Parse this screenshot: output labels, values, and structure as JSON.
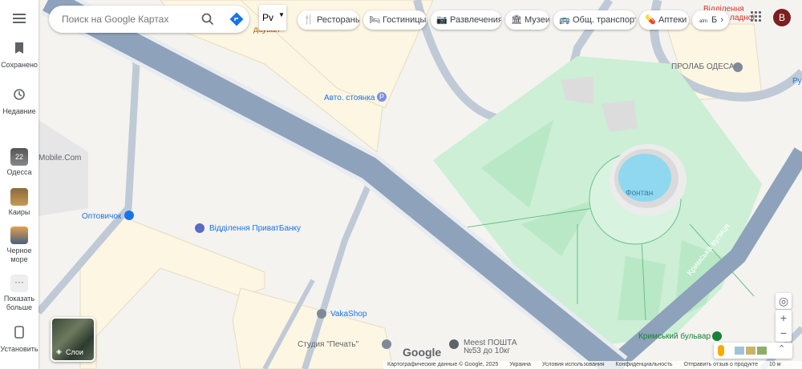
{
  "sidebar": {
    "menu_icon": "hamburger-icon",
    "items": [
      {
        "icon": "bookmark-icon",
        "label": "Сохранено"
      },
      {
        "icon": "history-icon",
        "label": "Недавние"
      },
      {
        "icon": "place-thumb",
        "label": "Одесса",
        "badge": "22"
      },
      {
        "icon": "place-thumb",
        "label": "Каиры"
      },
      {
        "icon": "place-thumb",
        "label": "Черное море"
      },
      {
        "icon": "more-dots-icon",
        "label": "Показать больше"
      },
      {
        "icon": "phone-icon",
        "label": "Установить"
      }
    ]
  },
  "search": {
    "placeholder": "Поиск на Google Картах"
  },
  "language_btn": "Рv",
  "chips": [
    {
      "icon": "fork-knife-icon",
      "label": "Рестораны"
    },
    {
      "icon": "bed-icon",
      "label": "Гостиницы"
    },
    {
      "icon": "camera-icon",
      "label": "Развлечения"
    },
    {
      "icon": "museum-icon",
      "label": "Музеи"
    },
    {
      "icon": "bus-icon",
      "label": "Общ. транспорт"
    },
    {
      "icon": "pharmacy-icon",
      "label": "Аптеки"
    },
    {
      "icon": "atm-icon",
      "label": "Б"
    }
  ],
  "account_initial": "B",
  "map_labels": {
    "parking": "Авто. стоянка",
    "parking_icon": "P",
    "mobile": "Mobile.Com",
    "optovichok": "Оптовичок",
    "privatbank": "Відділення ПриватБанку",
    "vakashop": "VakaShop",
    "studio": "Студия \"Печать\"",
    "meest": "Meest ПОШТА №53 до 10кг",
    "fountain": "Фонтан",
    "prolab": "ПРОЛАБ ОДЕСА",
    "branch_top": "Відділення",
    "branch_top2": "ладної",
    "street": "Кримська вулиця",
    "boulevard": "Кримський бульвар",
    "dauvan": "дауван",
    "right_edge": "Ру"
  },
  "layers": {
    "label": "Слои"
  },
  "footer": {
    "items": [
      "Картографические данные © Google, 2025",
      "Украина",
      "Условия использования",
      "Конфиденциальность",
      "Отправить отзыв о продукте",
      "10 м"
    ],
    "google": "Google"
  },
  "colors": {
    "park": "#c8eed3",
    "road_major": "#8ea2bb",
    "building": "#fdf6e3",
    "water": "#8fd8f0"
  }
}
